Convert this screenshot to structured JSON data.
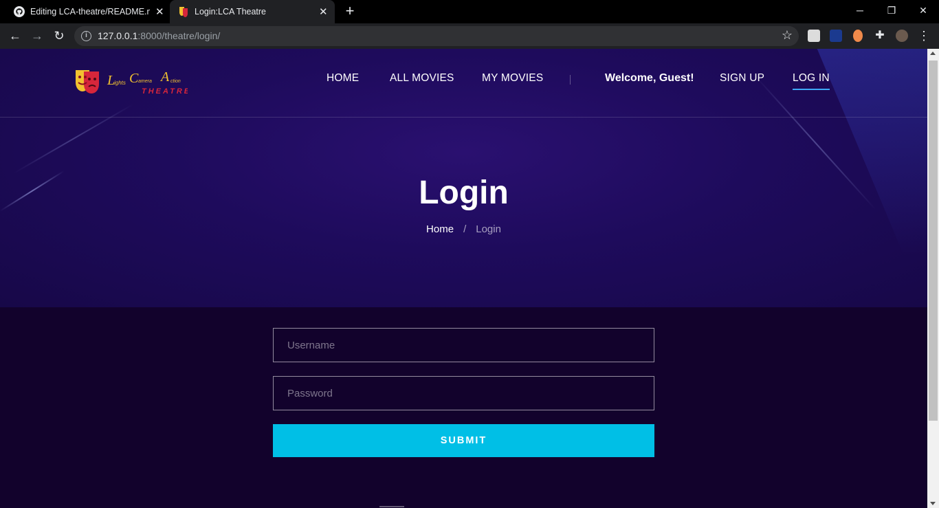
{
  "browser": {
    "tabs": [
      {
        "title": "Editing LCA-theatre/README.md",
        "icon": "github-icon"
      },
      {
        "title": "Login:LCA Theatre",
        "icon": "theatre-mask-icon"
      }
    ],
    "url_host": "127.0.0.1",
    "url_rest": ":8000/theatre/login/"
  },
  "site": {
    "logo_text": "Lights Camera Action THEATRE",
    "nav": {
      "home": "HOME",
      "all_movies": "ALL MOVIES",
      "my_movies": "MY MOVIES",
      "welcome": "Welcome, Guest!",
      "sign_up": "SIGN UP",
      "log_in": "LOG IN"
    },
    "accent": "#00bfe6"
  },
  "hero": {
    "title": "Login",
    "breadcrumb_home": "Home",
    "breadcrumb_sep": "/",
    "breadcrumb_current": "Login"
  },
  "form": {
    "username_placeholder": "Username",
    "password_placeholder": "Password",
    "submit_label": "SUBMIT"
  }
}
